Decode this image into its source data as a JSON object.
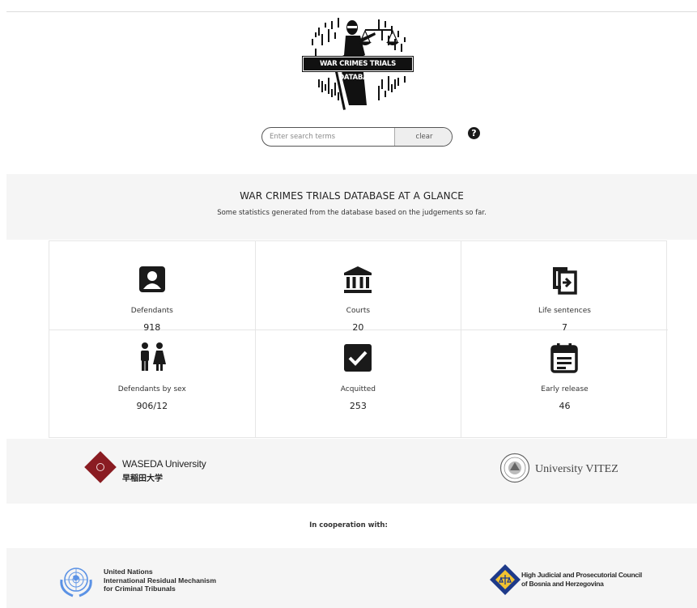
{
  "header": {
    "logo_text": "WAR CRIMES TRIALS DATABASE"
  },
  "search": {
    "placeholder": "Enter search terms",
    "value": "",
    "clear_label": "clear",
    "help_symbol": "?",
    "help_icon": "question-circle-icon"
  },
  "glance": {
    "title": "WAR CRIMES TRIALS DATABASE AT A GLANCE",
    "subtitle": "Some statistics generated from the database based on the judgements so far."
  },
  "stats": [
    {
      "label": "Defendants",
      "value": "918",
      "icon": "person-badge-icon"
    },
    {
      "label": "Courts",
      "value": "20",
      "icon": "courthouse-icon"
    },
    {
      "label": "Life sentences",
      "value": "7",
      "icon": "exit-arrow-icon"
    },
    {
      "label": "Defendants by sex",
      "value": "906/12",
      "icon": "male-female-icon"
    },
    {
      "label": "Acquitted",
      "value": "253",
      "icon": "checkbox-checked-icon"
    },
    {
      "label": "Early release",
      "value": "46",
      "icon": "calendar-icon"
    }
  ],
  "partners": {
    "waseda_name": "WASEDA University",
    "waseda_japanese": "早稲田大学",
    "vitez_name": "University VITEZ"
  },
  "cooperation": {
    "label": "In cooperation with:",
    "un_lines": [
      "United Nations",
      "International Residual Mechanism",
      "for Criminal Tribunals"
    ],
    "hjpc_lines": [
      "High Judicial and Prosecutorial Council",
      "of Bosnia and Herzegovina"
    ]
  },
  "colors": {
    "panel_background": "#f5f5f5",
    "icon": "#1a1a1a",
    "waseda_red": "#8a1c22",
    "un_blue": "#5b92e5",
    "hjpc_blue": "#1e3a8a",
    "hjpc_yellow": "#f2c230"
  }
}
